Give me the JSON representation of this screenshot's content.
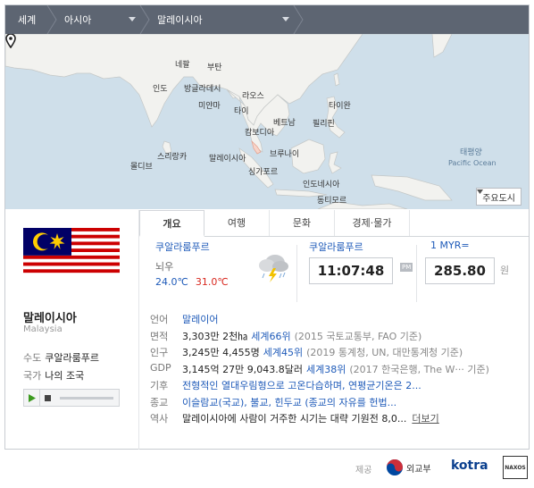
{
  "breadcrumb": {
    "items": [
      {
        "label": "세계"
      },
      {
        "label": "아시아"
      },
      {
        "label": "말레이시아"
      }
    ]
  },
  "map": {
    "labels": {
      "nepal": "네팔",
      "bhutan": "부탄",
      "india": "인도",
      "bangladesh": "방글라데시",
      "myanmar": "미얀마",
      "laos": "라오스",
      "taiwan": "타이완",
      "thailand": "타이",
      "vietnam": "베트남",
      "philippines": "필리핀",
      "cambodia": "캄보디아",
      "srilanka": "스리랑카",
      "maldives": "몰디브",
      "malaysia": "말레이시아",
      "brunei": "브루나이",
      "singapore": "싱가포르",
      "indonesia": "인도네시아",
      "easttimor": "동티모르",
      "pacific_ko": "태평양",
      "pacific_en": "Pacific Ocean"
    },
    "major_cities_button": "주요도시"
  },
  "country": {
    "name": "말레이시아",
    "name_en": "Malaysia",
    "capital_label": "수도",
    "capital": "쿠알라룸푸르",
    "anthem_label": "국가",
    "anthem": "나의 조국"
  },
  "tabs": [
    {
      "label": "개요",
      "active": true
    },
    {
      "label": "여행",
      "active": false
    },
    {
      "label": "문화",
      "active": false
    },
    {
      "label": "경제·물가",
      "active": false
    }
  ],
  "weather": {
    "city": "쿠알라룸푸르",
    "condition": "뇌우",
    "low": "24.0℃",
    "high": "31.0℃"
  },
  "clock": {
    "city": "쿠알라룸푸르",
    "time": "11:07:48",
    "ampm": "PM"
  },
  "currency": {
    "unit": "1 MYR=",
    "value": "285.80",
    "won": "원"
  },
  "info": {
    "language": {
      "label": "언어",
      "value": "말레이어"
    },
    "area": {
      "label": "면적",
      "value": "3,303만 2천㏊",
      "rank": "세계66위",
      "source": "(2015 국토교통부, FAO 기준)"
    },
    "population": {
      "label": "인구",
      "value": "3,245만 4,455명",
      "rank": "세계45위",
      "source": "(2019 통계청, UN, 대만통계청 기준)"
    },
    "gdp": {
      "label": "GDP",
      "value": "3,145억 27만 9,043.8달러",
      "rank": "세계38위",
      "source": "(2017 한국은행, The W··· 기준)"
    },
    "climate": {
      "label": "기후",
      "value": "전형적인 열대우림형으로 고온다습하며, 연평균기온은 2..."
    },
    "religion": {
      "label": "종교",
      "value": "이슬람교(국교), 불교, 힌두교 (종교의 자유를 헌법..."
    },
    "history": {
      "label": "역사",
      "value": "말레이시아에 사람이 거주한 시기는 대략 기원전 8,0...",
      "more": "더보기"
    }
  },
  "footer": {
    "provider_label": "제공",
    "mofa": "외교부",
    "kotra": "kotra",
    "naxos": "NAXOS"
  },
  "colors": {
    "header_bg": "#5d6572",
    "link_blue": "#1f5bb9",
    "temp_high": "#d8281f",
    "sea": "#cfdfea",
    "land": "#f2f2ef"
  }
}
